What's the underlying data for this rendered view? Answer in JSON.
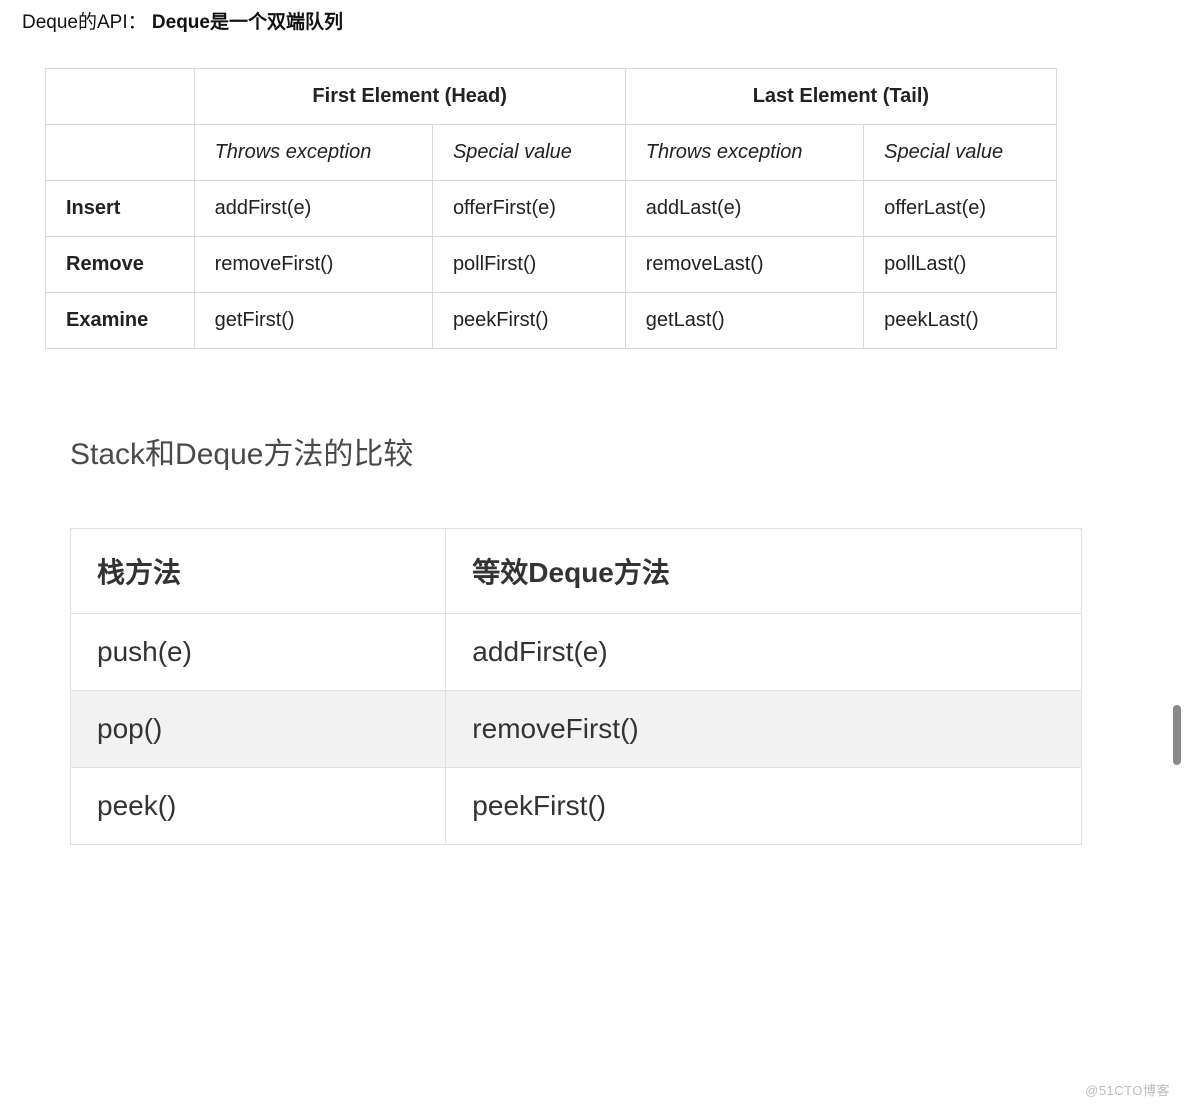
{
  "intro": {
    "prefix": "Deque的API：",
    "bold": "Deque是一个双端队列"
  },
  "api_table": {
    "head": {
      "first": "First Element (Head)",
      "last": "Last Element (Tail)"
    },
    "sub": {
      "throws1": "Throws exception",
      "special1": "Special value",
      "throws2": "Throws exception",
      "special2": "Special value"
    },
    "rows": [
      {
        "label": "Insert",
        "c1": "addFirst(e)",
        "c2": "offerFirst(e)",
        "c3": "addLast(e)",
        "c4": "offerLast(e)"
      },
      {
        "label": "Remove",
        "c1": "removeFirst()",
        "c2": "pollFirst()",
        "c3": "removeLast()",
        "c4": "pollLast()"
      },
      {
        "label": "Examine",
        "c1": "getFirst()",
        "c2": "peekFirst()",
        "c3": "getLast()",
        "c4": "peekLast()"
      }
    ]
  },
  "section_title": "Stack和Deque方法的比较",
  "compare_table": {
    "head": {
      "stack": "栈方法",
      "deque": "等效Deque方法"
    },
    "rows": [
      {
        "stack": "push(e)",
        "deque": "addFirst(e)",
        "shaded": false
      },
      {
        "stack": "pop()",
        "deque": "removeFirst()",
        "shaded": true
      },
      {
        "stack": "peek()",
        "deque": "peekFirst()",
        "shaded": false
      }
    ]
  },
  "watermark": "@51CTO博客"
}
